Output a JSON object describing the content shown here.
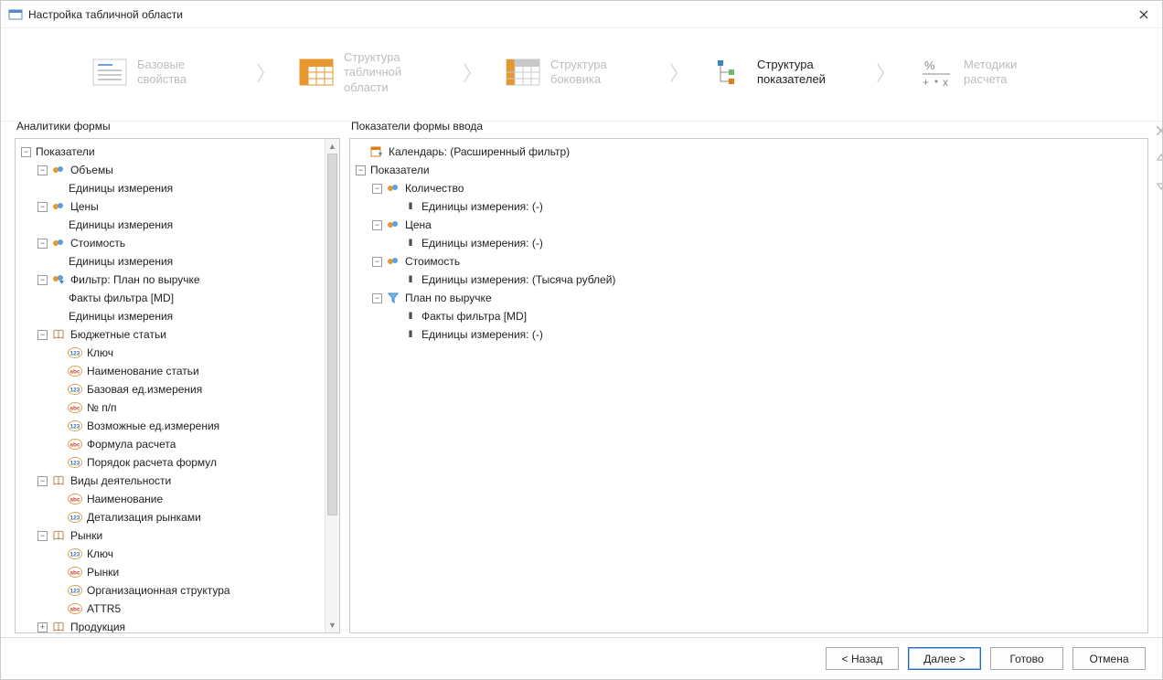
{
  "window": {
    "title": "Настройка табличной области"
  },
  "steps": [
    {
      "l1": "Базовые",
      "l2": "свойства",
      "active": false
    },
    {
      "l1": "Структура",
      "l2": "табличной",
      "l3": "области",
      "active": false
    },
    {
      "l1": "Структура",
      "l2": "боковика",
      "active": false
    },
    {
      "l1": "Структура",
      "l2": "показателей",
      "active": true
    },
    {
      "l1": "Методики",
      "l2": "расчета",
      "active": false
    }
  ],
  "left": {
    "title": "Аналитики формы",
    "tree": [
      {
        "d": 0,
        "tog": "-",
        "ic": "",
        "text": "Показатели"
      },
      {
        "d": 1,
        "tog": "-",
        "ic": "sci",
        "text": "Объемы"
      },
      {
        "d": 2,
        "tog": "",
        "ic": "",
        "text": "Единицы измерения"
      },
      {
        "d": 1,
        "tog": "-",
        "ic": "sci",
        "text": "Цены"
      },
      {
        "d": 2,
        "tog": "",
        "ic": "",
        "text": "Единицы измерения"
      },
      {
        "d": 1,
        "tog": "-",
        "ic": "sci",
        "text": "Стоимость"
      },
      {
        "d": 2,
        "tog": "",
        "ic": "",
        "text": "Единицы измерения"
      },
      {
        "d": 1,
        "tog": "-",
        "ic": "filt",
        "text": "Фильтр: План по выручке"
      },
      {
        "d": 2,
        "tog": "",
        "ic": "",
        "text": "Факты фильтра [MD]"
      },
      {
        "d": 2,
        "tog": "",
        "ic": "",
        "text": "Единицы измерения"
      },
      {
        "d": 1,
        "tog": "-",
        "ic": "book",
        "text": "Бюджетные статьи"
      },
      {
        "d": 2,
        "tog": "",
        "ic": "123",
        "text": "Ключ"
      },
      {
        "d": 2,
        "tog": "",
        "ic": "abc",
        "text": "Наименование статьи"
      },
      {
        "d": 2,
        "tog": "",
        "ic": "123",
        "text": "Базовая ед.измерения"
      },
      {
        "d": 2,
        "tog": "",
        "ic": "abc",
        "text": "№ п/п"
      },
      {
        "d": 2,
        "tog": "",
        "ic": "123",
        "text": "Возможные ед.измерения"
      },
      {
        "d": 2,
        "tog": "",
        "ic": "abc",
        "text": "Формула расчета"
      },
      {
        "d": 2,
        "tog": "",
        "ic": "123",
        "text": "Порядок расчета формул"
      },
      {
        "d": 1,
        "tog": "-",
        "ic": "book",
        "text": "Виды деятельности"
      },
      {
        "d": 2,
        "tog": "",
        "ic": "abc",
        "text": "Наименование"
      },
      {
        "d": 2,
        "tog": "",
        "ic": "123",
        "text": "Детализация рынками"
      },
      {
        "d": 1,
        "tog": "-",
        "ic": "book",
        "text": "Рынки"
      },
      {
        "d": 2,
        "tog": "",
        "ic": "123",
        "text": "Ключ"
      },
      {
        "d": 2,
        "tog": "",
        "ic": "abc",
        "text": "Рынки"
      },
      {
        "d": 2,
        "tog": "",
        "ic": "123",
        "text": "Организационная структура"
      },
      {
        "d": 2,
        "tog": "",
        "ic": "abc",
        "text": "ATTR5"
      },
      {
        "d": 1,
        "tog": "+",
        "ic": "book",
        "text": "Продукция"
      }
    ]
  },
  "right": {
    "title": "Показатели формы ввода",
    "tree": [
      {
        "d": 0,
        "tog": "",
        "ic": "cal",
        "text": "Календарь: (Расширенный фильтр)"
      },
      {
        "d": 0,
        "tog": "-",
        "ic": "",
        "text": "Показатели"
      },
      {
        "d": 1,
        "tog": "-",
        "ic": "sci",
        "text": "Количество"
      },
      {
        "d": 2,
        "tog": "",
        "ic": "bars",
        "text": "Единицы измерения: (-)"
      },
      {
        "d": 1,
        "tog": "-",
        "ic": "sci",
        "text": "Цена"
      },
      {
        "d": 2,
        "tog": "",
        "ic": "bars",
        "text": "Единицы измерения: (-)"
      },
      {
        "d": 1,
        "tog": "-",
        "ic": "sci",
        "text": "Стоимость"
      },
      {
        "d": 2,
        "tog": "",
        "ic": "bars",
        "text": "Единицы измерения: (Тысяча рублей)"
      },
      {
        "d": 1,
        "tog": "-",
        "ic": "funnel",
        "text": "План по выручке"
      },
      {
        "d": 2,
        "tog": "",
        "ic": "bars",
        "text": "Факты фильтра [MD]"
      },
      {
        "d": 2,
        "tog": "",
        "ic": "bars",
        "text": "Единицы измерения: (-)"
      }
    ]
  },
  "buttons": {
    "back": "< Назад",
    "next": "Далее >",
    "finish": "Готово",
    "cancel": "Отмена"
  }
}
